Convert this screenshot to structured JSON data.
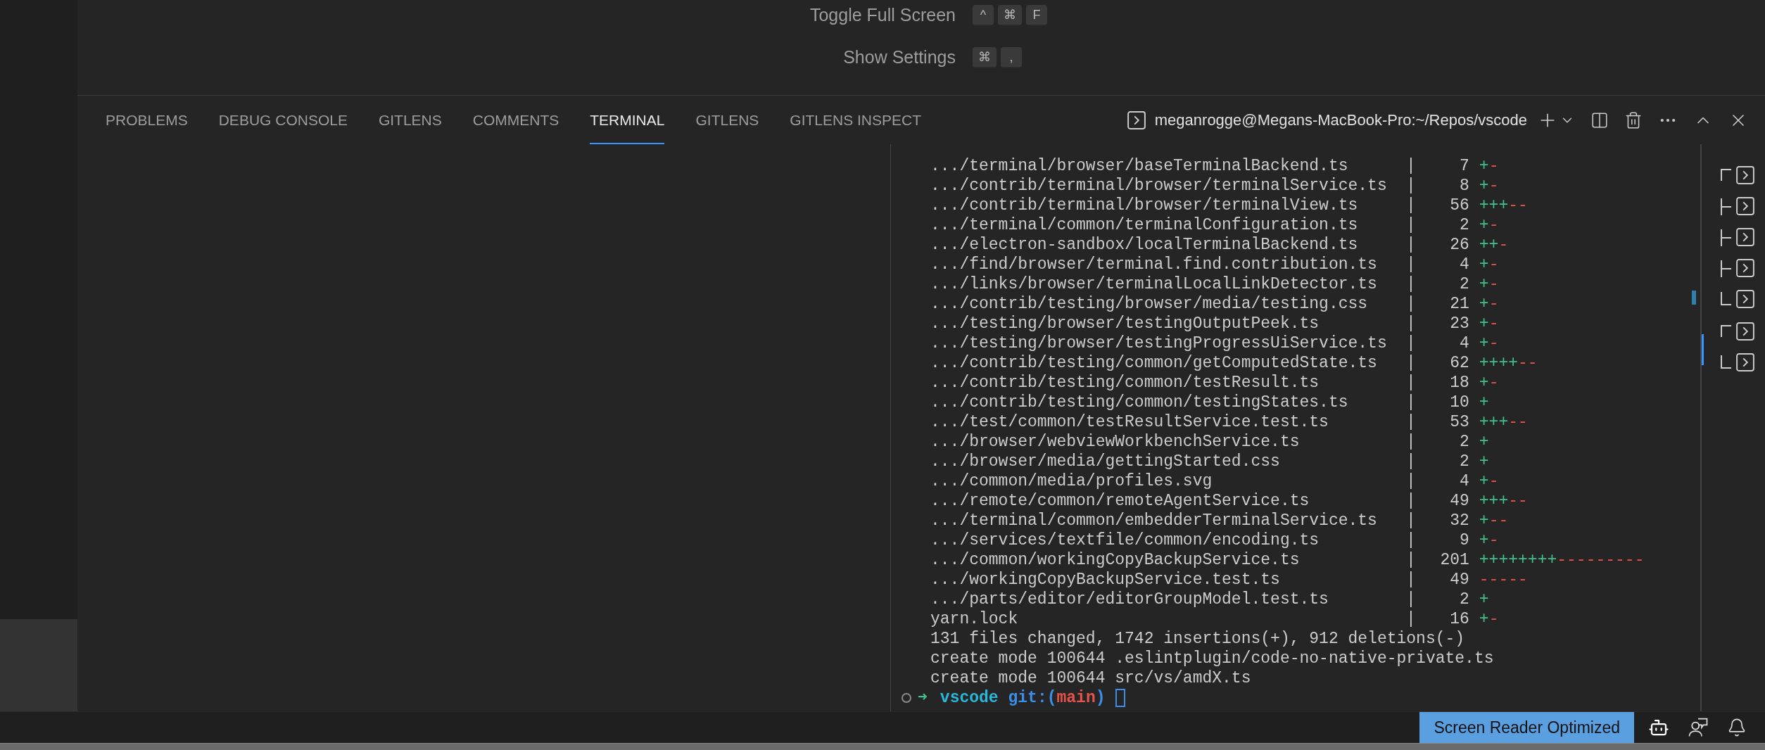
{
  "shortcuts": [
    {
      "label": "Toggle Full Screen",
      "keys": [
        "^",
        "⌘",
        "F"
      ]
    },
    {
      "label": "Show Settings",
      "keys": [
        "⌘",
        ","
      ]
    }
  ],
  "panel_tabs": [
    {
      "label": "PROBLEMS",
      "selected": false
    },
    {
      "label": "DEBUG CONSOLE",
      "selected": false
    },
    {
      "label": "GITLENS",
      "selected": false
    },
    {
      "label": "COMMENTS",
      "selected": false
    },
    {
      "label": "TERMINAL",
      "selected": true
    },
    {
      "label": "GITLENS",
      "selected": false
    },
    {
      "label": "GITLENS INSPECT",
      "selected": false
    }
  ],
  "terminal_title": "meganrogge@Megans-MacBook-Pro:~/Repos/vscode",
  "diffstat": [
    {
      "path": ".../terminal/browser/baseTerminalBackend.ts",
      "bar": "|",
      "count": "7",
      "plus": "+",
      "minus": "-"
    },
    {
      "path": ".../contrib/terminal/browser/terminalService.ts",
      "bar": "|",
      "count": "8",
      "plus": "+",
      "minus": "-"
    },
    {
      "path": ".../contrib/terminal/browser/terminalView.ts",
      "bar": "|",
      "count": "56",
      "plus": "+++",
      "minus": "--"
    },
    {
      "path": ".../terminal/common/terminalConfiguration.ts",
      "bar": "|",
      "count": "2",
      "plus": "+",
      "minus": "-"
    },
    {
      "path": ".../electron-sandbox/localTerminalBackend.ts",
      "bar": "|",
      "count": "26",
      "plus": "++",
      "minus": "-"
    },
    {
      "path": ".../find/browser/terminal.find.contribution.ts",
      "bar": "|",
      "count": "4",
      "plus": "+",
      "minus": "-"
    },
    {
      "path": ".../links/browser/terminalLocalLinkDetector.ts",
      "bar": "|",
      "count": "2",
      "plus": "+",
      "minus": "-"
    },
    {
      "path": ".../contrib/testing/browser/media/testing.css",
      "bar": "|",
      "count": "21",
      "plus": "+",
      "minus": "-"
    },
    {
      "path": ".../testing/browser/testingOutputPeek.ts",
      "bar": "|",
      "count": "23",
      "plus": "+",
      "minus": "-"
    },
    {
      "path": ".../testing/browser/testingProgressUiService.ts",
      "bar": "|",
      "count": "4",
      "plus": "+",
      "minus": "-"
    },
    {
      "path": ".../contrib/testing/common/getComputedState.ts",
      "bar": "|",
      "count": "62",
      "plus": "++++",
      "minus": "--"
    },
    {
      "path": ".../contrib/testing/common/testResult.ts",
      "bar": "|",
      "count": "18",
      "plus": "+",
      "minus": "-"
    },
    {
      "path": ".../contrib/testing/common/testingStates.ts",
      "bar": "|",
      "count": "10",
      "plus": "+"
    },
    {
      "path": ".../test/common/testResultService.test.ts",
      "bar": "|",
      "count": "53",
      "plus": "+++",
      "minus": "--"
    },
    {
      "path": ".../browser/webviewWorkbenchService.ts",
      "bar": "|",
      "count": "2",
      "plus": "+"
    },
    {
      "path": ".../browser/media/gettingStarted.css",
      "bar": "|",
      "count": "2",
      "plus": "+"
    },
    {
      "path": ".../common/media/profiles.svg",
      "bar": "|",
      "count": "4",
      "plus": "+",
      "minus": "-"
    },
    {
      "path": ".../remote/common/remoteAgentService.ts",
      "bar": "|",
      "count": "49",
      "plus": "+++",
      "minus": "--"
    },
    {
      "path": ".../terminal/common/embedderTerminalService.ts",
      "bar": "|",
      "count": "32",
      "plus": "+",
      "minus": "--"
    },
    {
      "path": ".../services/textfile/common/encoding.ts",
      "bar": "|",
      "count": "9",
      "plus": "+",
      "minus": "-"
    },
    {
      "path": ".../common/workingCopyBackupService.ts",
      "bar": "|",
      "count": "201",
      "plus": "++++++++",
      "minus": "---------"
    },
    {
      "path": ".../workingCopyBackupService.test.ts",
      "bar": "|",
      "count": "49",
      "minus": "-----"
    },
    {
      "path": ".../parts/editor/editorGroupModel.test.ts",
      "bar": "|",
      "count": "2",
      "plus": "+"
    },
    {
      "path": "yarn.lock",
      "bar": "|",
      "count": "16",
      "plus": "+",
      "minus": "-"
    }
  ],
  "output_lines": [
    "131 files changed, 1742 insertions(+), 912 deletions(-)",
    "create mode 100644 .eslintplugin/code-no-native-private.ts",
    "create mode 100644 src/vs/amdX.ts"
  ],
  "prompt": {
    "arrow": "➜",
    "directory": "vscode",
    "git_open": "git:(",
    "branch": "main",
    "git_close": ")"
  },
  "command_marks": [
    {
      "kind": "first"
    },
    {
      "kind": "middle"
    },
    {
      "kind": "middle"
    },
    {
      "kind": "middle"
    },
    {
      "kind": "last"
    },
    {
      "kind": "first"
    },
    {
      "kind": "last"
    }
  ],
  "status_bar": {
    "badge": "Screen Reader Optimized"
  }
}
